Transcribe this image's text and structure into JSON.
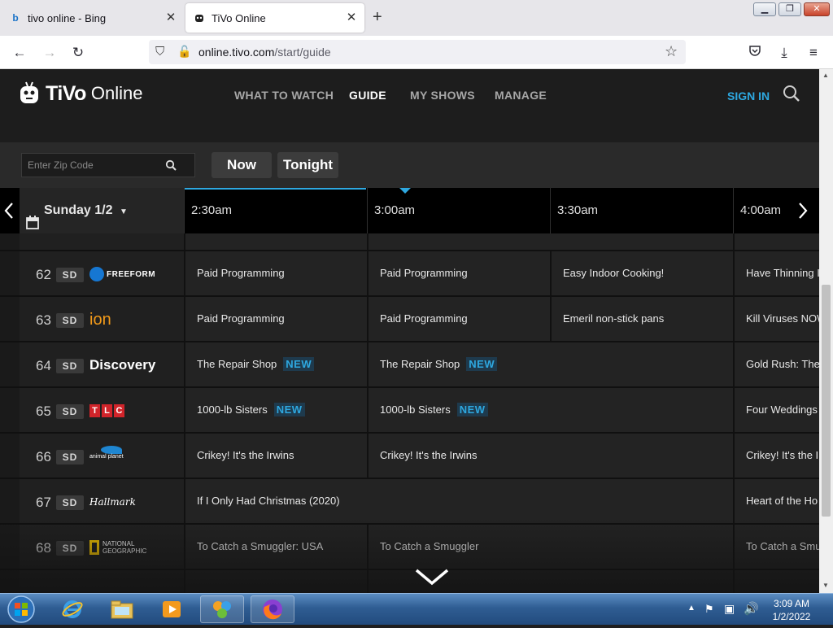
{
  "browser": {
    "tabs": [
      {
        "title": "tivo online - Bing",
        "icon": "bing-icon"
      },
      {
        "title": "TiVo Online",
        "icon": "tivo-icon"
      }
    ],
    "url_host": "online.tivo.com",
    "url_path": "/start/guide"
  },
  "site": {
    "brand": "TiVo",
    "brand_suffix": "Online",
    "nav": [
      "WHAT TO WATCH",
      "GUIDE",
      "MY SHOWS",
      "MANAGE"
    ],
    "active_nav": "GUIDE",
    "sign_in": "SIGN IN"
  },
  "filters": {
    "zip_placeholder": "Enter Zip Code",
    "now_label": "Now",
    "tonight_label": "Tonight"
  },
  "timebar": {
    "date": "Sunday 1/2",
    "times": [
      "2:30am",
      "3:00am",
      "3:30am",
      "4:00am"
    ]
  },
  "channels": [
    {
      "num": "62",
      "quality": "SD",
      "network": "FREEFORM",
      "programs": [
        "Paid Programming",
        "Paid Programming",
        "Easy Indoor Cooking!",
        "Have Thinning I"
      ],
      "new": [
        false,
        false,
        false,
        false
      ]
    },
    {
      "num": "63",
      "quality": "SD",
      "network": "ion",
      "programs": [
        "Paid Programming",
        "Paid Programming",
        "Emeril non-stick pans",
        "Kill Viruses NOW"
      ],
      "new": [
        false,
        false,
        false,
        false
      ]
    },
    {
      "num": "64",
      "quality": "SD",
      "network": "Discovery",
      "programs": [
        "The Repair Shop",
        "The Repair Shop",
        "Gold Rush: The"
      ],
      "new": [
        true,
        true,
        false
      ]
    },
    {
      "num": "65",
      "quality": "SD",
      "network": "TLC",
      "programs": [
        "1000-lb Sisters",
        "1000-lb Sisters",
        "Four Weddings"
      ],
      "new": [
        true,
        true,
        false
      ]
    },
    {
      "num": "66",
      "quality": "SD",
      "network": "animal planet",
      "programs": [
        "Crikey! It's the Irwins",
        "Crikey! It's the Irwins",
        "Crikey! It's the I"
      ],
      "new": [
        false,
        false,
        false
      ]
    },
    {
      "num": "67",
      "quality": "SD",
      "network": "Hallmark",
      "programs": [
        "If I Only Had Christmas (2020)",
        "Heart of the Ho"
      ],
      "new": [
        false,
        false
      ]
    },
    {
      "num": "68",
      "quality": "SD",
      "network": "NATIONAL GEOGRAPHIC",
      "programs": [
        "To Catch a Smuggler: USA",
        "To Catch a Smuggler",
        "To Catch a Smu"
      ],
      "new": [
        false,
        false,
        false
      ]
    }
  ],
  "new_badge": "NEW",
  "taskbar": {
    "time": "3:09 AM",
    "date": "1/2/2022"
  }
}
